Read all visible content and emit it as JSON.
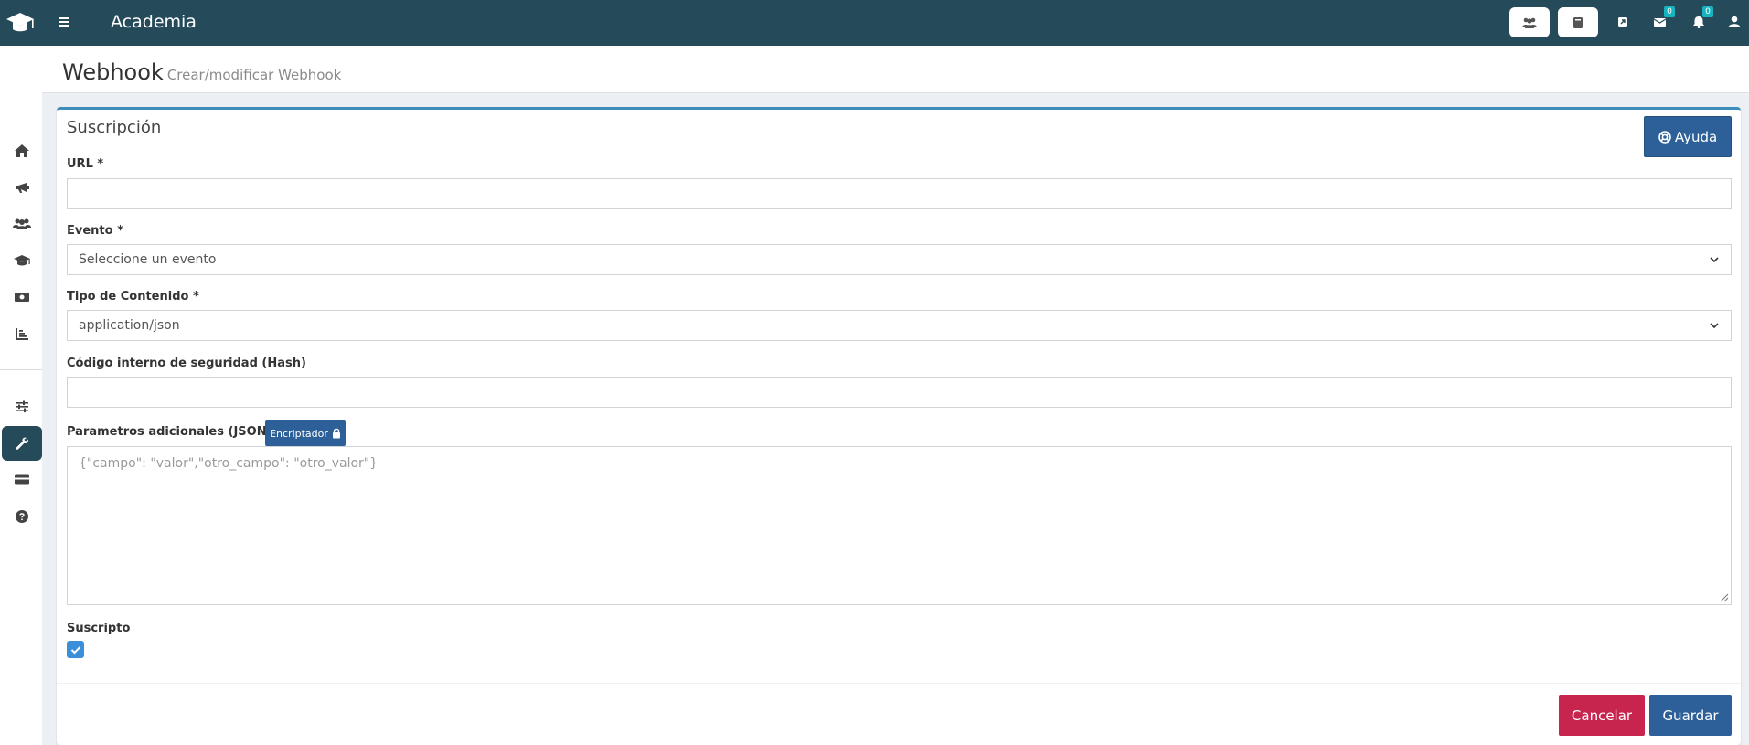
{
  "app": {
    "title": "Academia"
  },
  "topbar": {
    "icons": [
      "group-icon",
      "book-icon",
      "external-link-icon",
      "mail-icon",
      "bell-icon",
      "user-icon"
    ],
    "mail_count": "0",
    "notif_count": "0"
  },
  "sidebar": {
    "items": [
      "home-icon",
      "bullhorn-icon",
      "users-icon",
      "graduation-cap-icon",
      "money-icon",
      "chart-icon",
      "sliders-icon",
      "wrench-icon",
      "credit-card-icon",
      "question-icon"
    ],
    "active": "wrench-icon"
  },
  "header": {
    "title": "Webhook",
    "subtitle": "Crear/modificar Webhook"
  },
  "card": {
    "title": "Suscripción",
    "help_label": "Ayuda"
  },
  "form": {
    "url_label": "URL *",
    "url_value": "",
    "event_label": "Evento *",
    "event_value": "Seleccione un evento",
    "content_type_label": "Tipo de Contenido *",
    "content_type_value": "application/json",
    "hash_label": "Código interno de seguridad (Hash)",
    "hash_value": "",
    "params_label": "Parametros adicionales (JSON)",
    "encrypt_label": "Encriptador",
    "params_placeholder": "{\"campo\": \"valor\",\"otro_campo\": \"otro_valor\"}",
    "subscribed_label": "Suscripto",
    "subscribed": true
  },
  "actions": {
    "cancel_label": "Cancelar",
    "save_label": "Guardar"
  },
  "colors": {
    "topbar": "#254b5b",
    "primary": "#2d6098",
    "danger": "#c7254e",
    "accent": "#3c8dbc"
  }
}
